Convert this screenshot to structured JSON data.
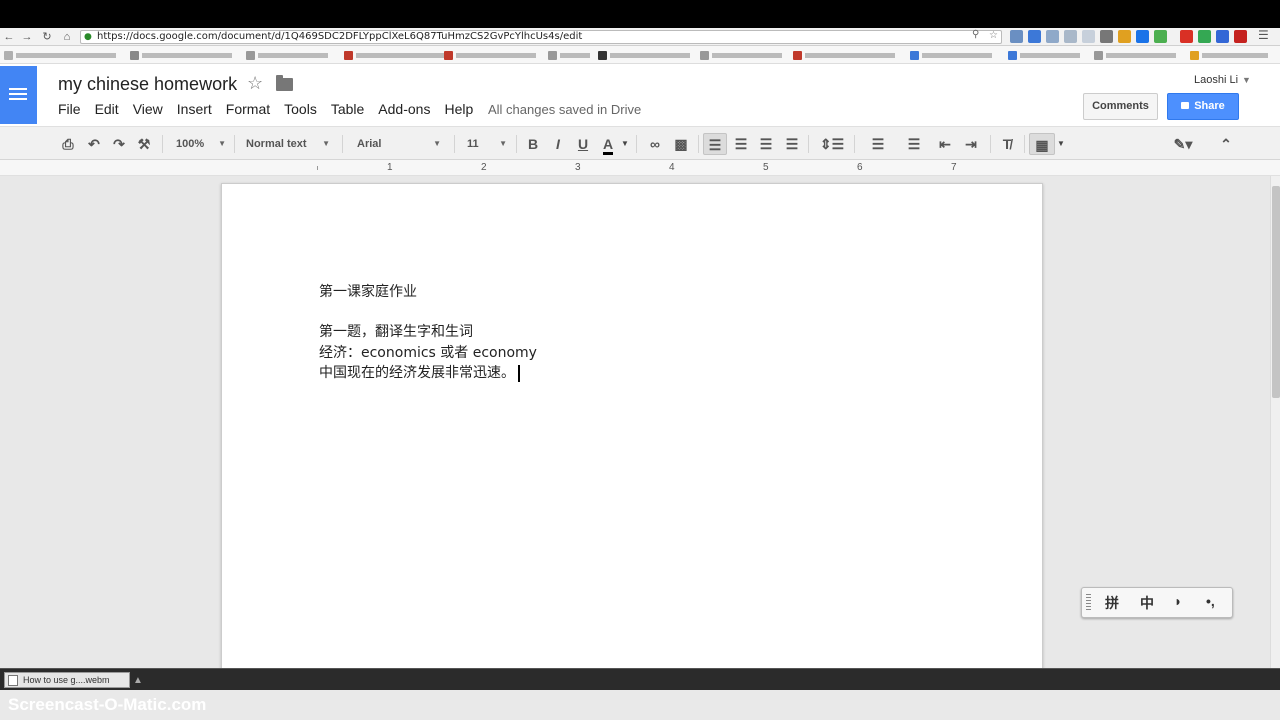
{
  "browser": {
    "url": "https://docs.google.com/document/d/1Q469SDC2DFLYppClXeL6Q87TuHmzCS2GvPcYlhcUs4s/edit"
  },
  "document": {
    "title": "my chinese homework",
    "menu": [
      "File",
      "Edit",
      "View",
      "Insert",
      "Format",
      "Tools",
      "Table",
      "Add-ons",
      "Help"
    ],
    "save_status": "All changes saved in Drive",
    "user_name": "Laoshi Li",
    "comments_label": "Comments",
    "share_label": "Share"
  },
  "toolbar": {
    "zoom": "100%",
    "style": "Normal text",
    "font": "Arial",
    "size": "11",
    "bold": "B",
    "italic": "I",
    "underline": "U",
    "text_color": "A"
  },
  "ruler": {
    "numbers": [
      "1",
      "2",
      "3",
      "4",
      "5",
      "6",
      "7"
    ]
  },
  "content": {
    "lines": [
      "第一课家庭作业",
      "第一题，翻译生字和生词",
      "经济：economics 或者 economy",
      "中国现在的经济发展非常迅速。"
    ]
  },
  "ime": {
    "pinyin": "拼",
    "chinese": "中",
    "moon": "◗",
    "punct": "•,"
  },
  "taskbar": {
    "task_label": "How to use g....webm"
  },
  "watermark": "Screencast-O-Matic.com",
  "colors": {
    "docs_blue": "#4285f4",
    "share_blue": "#4d90fe"
  }
}
